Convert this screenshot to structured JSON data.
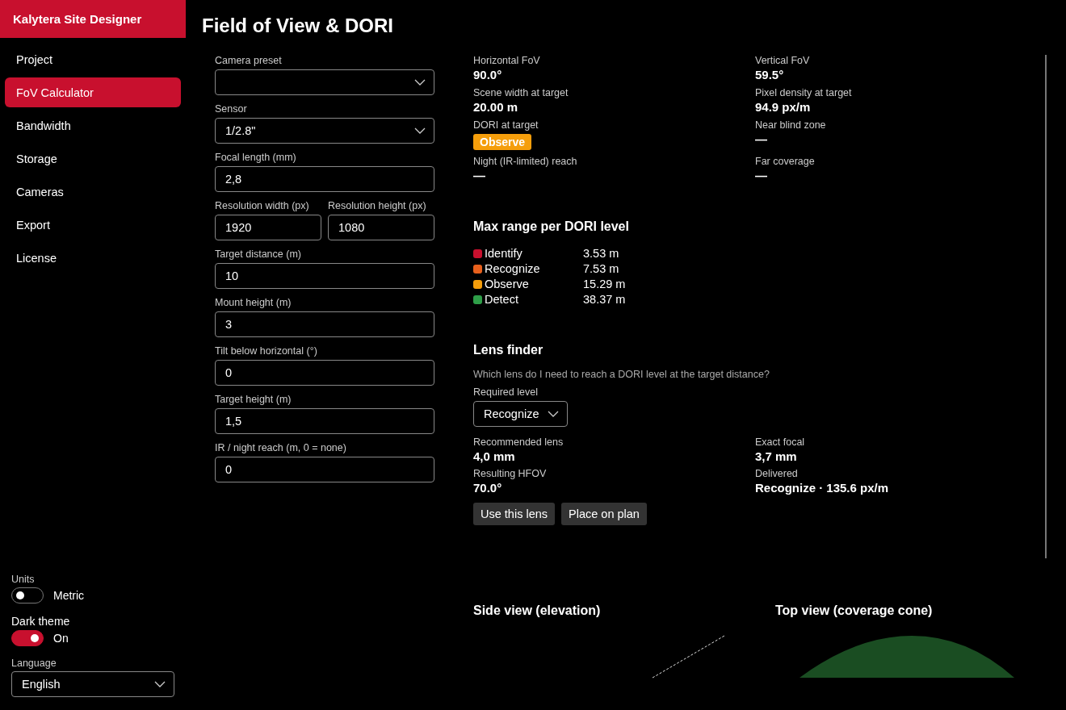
{
  "sidebar": {
    "brand": "Kalytera Site Designer",
    "items": [
      {
        "label": "Project",
        "selected": false
      },
      {
        "label": "FoV Calculator",
        "selected": true
      },
      {
        "label": "Bandwidth",
        "selected": false
      },
      {
        "label": "Storage",
        "selected": false
      },
      {
        "label": "Cameras",
        "selected": false
      },
      {
        "label": "Export",
        "selected": false
      },
      {
        "label": "License",
        "selected": false
      }
    ],
    "settings": [
      {
        "kind": "toggle",
        "label": "Units",
        "on": false,
        "toggle_text": "Metric"
      },
      {
        "kind": "toggle",
        "label": "Dark theme",
        "on": true,
        "toggle_text": "On"
      },
      {
        "kind": "select",
        "label": "Language",
        "value": "English"
      }
    ]
  },
  "title": "Field of View & DORI",
  "form": [
    {
      "fields": [
        {
          "kind": "select",
          "label": "Camera preset"
        }
      ]
    },
    {
      "fields": [
        {
          "kind": "select",
          "label": "Sensor",
          "value": "1/2.8\""
        }
      ]
    },
    {
      "fields": [
        {
          "kind": "input",
          "label": "Focal length (mm)",
          "value": "2,8"
        }
      ]
    },
    {
      "fields": [
        {
          "kind": "input",
          "label": "Resolution width (px)",
          "value": "1920"
        },
        {
          "kind": "input",
          "label": "Resolution height (px)",
          "value": "1080"
        }
      ]
    },
    {
      "fields": [
        {
          "kind": "input",
          "label": "Target distance (m)",
          "value": "10"
        }
      ]
    },
    {
      "fields": [
        {
          "kind": "input",
          "label": "Mount height (m)",
          "value": "3"
        }
      ]
    },
    {
      "fields": [
        {
          "kind": "input",
          "label": "Tilt below horizontal (°)",
          "value": "0"
        }
      ]
    },
    {
      "fields": [
        {
          "kind": "input",
          "label": "Target height (m)",
          "value": "1,5"
        }
      ]
    },
    {
      "fields": [
        {
          "kind": "input",
          "label": "IR / night reach (m, 0 = none)",
          "value": "0"
        }
      ]
    }
  ],
  "results": [
    {
      "kind": "text",
      "label": "Horizontal FoV",
      "value": "90.0°"
    },
    {
      "kind": "text",
      "label": "Vertical FoV",
      "value": "59.5°"
    },
    {
      "kind": "text",
      "label": "Scene width at target",
      "value": "20.00 m"
    },
    {
      "kind": "text",
      "label": "Pixel density at target",
      "value": "94.9 px/m"
    },
    {
      "kind": "badge",
      "label": "DORI at target",
      "value": "Observe",
      "color": "#f59e0b"
    },
    {
      "kind": "text",
      "label": "Near blind zone",
      "value": "—"
    },
    {
      "kind": "text",
      "label": "Night (IR-limited) reach",
      "value": "—"
    },
    {
      "kind": "text",
      "label": "Far coverage",
      "value": "—"
    }
  ],
  "dori": {
    "title": "Max range per DORI level",
    "levels": [
      {
        "name": "Identify",
        "range": "3.53 m",
        "color": "#c8102e"
      },
      {
        "name": "Recognize",
        "range": "7.53 m",
        "color": "#e8601c"
      },
      {
        "name": "Observe",
        "range": "15.29 m",
        "color": "#f59e0b"
      },
      {
        "name": "Detect",
        "range": "38.37 m",
        "color": "#2e9e48"
      }
    ]
  },
  "lens_finder": {
    "title": "Lens finder",
    "description": "Which lens do I need to reach a DORI level at the target distance?",
    "required_label": "Required level",
    "required_value": "Recognize",
    "results": [
      {
        "label": "Recommended lens",
        "value": "4,0 mm"
      },
      {
        "label": "Exact focal",
        "value": "3,7 mm"
      },
      {
        "label": "Resulting HFOV",
        "value": "70.0°"
      },
      {
        "label": "Delivered",
        "value": "Recognize · 135.6 px/m"
      }
    ],
    "buttons": [
      "Use this lens",
      "Place on plan"
    ]
  },
  "views": [
    {
      "kind": "side",
      "title": "Side view (elevation)"
    },
    {
      "kind": "top",
      "title": "Top view (coverage cone)"
    }
  ]
}
